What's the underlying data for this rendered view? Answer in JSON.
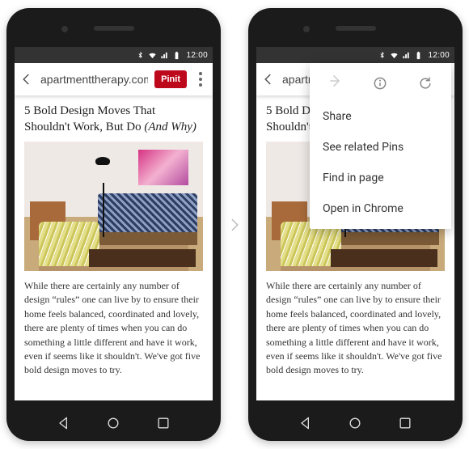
{
  "status": {
    "time": "12:00"
  },
  "urlbar": {
    "site": "apartmenttherapy.com",
    "pin_label": "Pinit"
  },
  "article": {
    "headline_plain": "5 Bold Design Moves That Shouldn't Work, But Do ",
    "headline_italic": "(And Why)",
    "body": "While there are certainly any number of design “rules” one can live by to ensure their home feels balanced, coordinated and lovely, there are plenty of times when you can do something a little different and have it work, even if seems like it shouldn't. We've got five bold design moves to try."
  },
  "menu": {
    "items": [
      "Share",
      "See related Pins",
      "Find in page",
      "Open in Chrome"
    ]
  },
  "right_urlbar_visible": "apartm"
}
